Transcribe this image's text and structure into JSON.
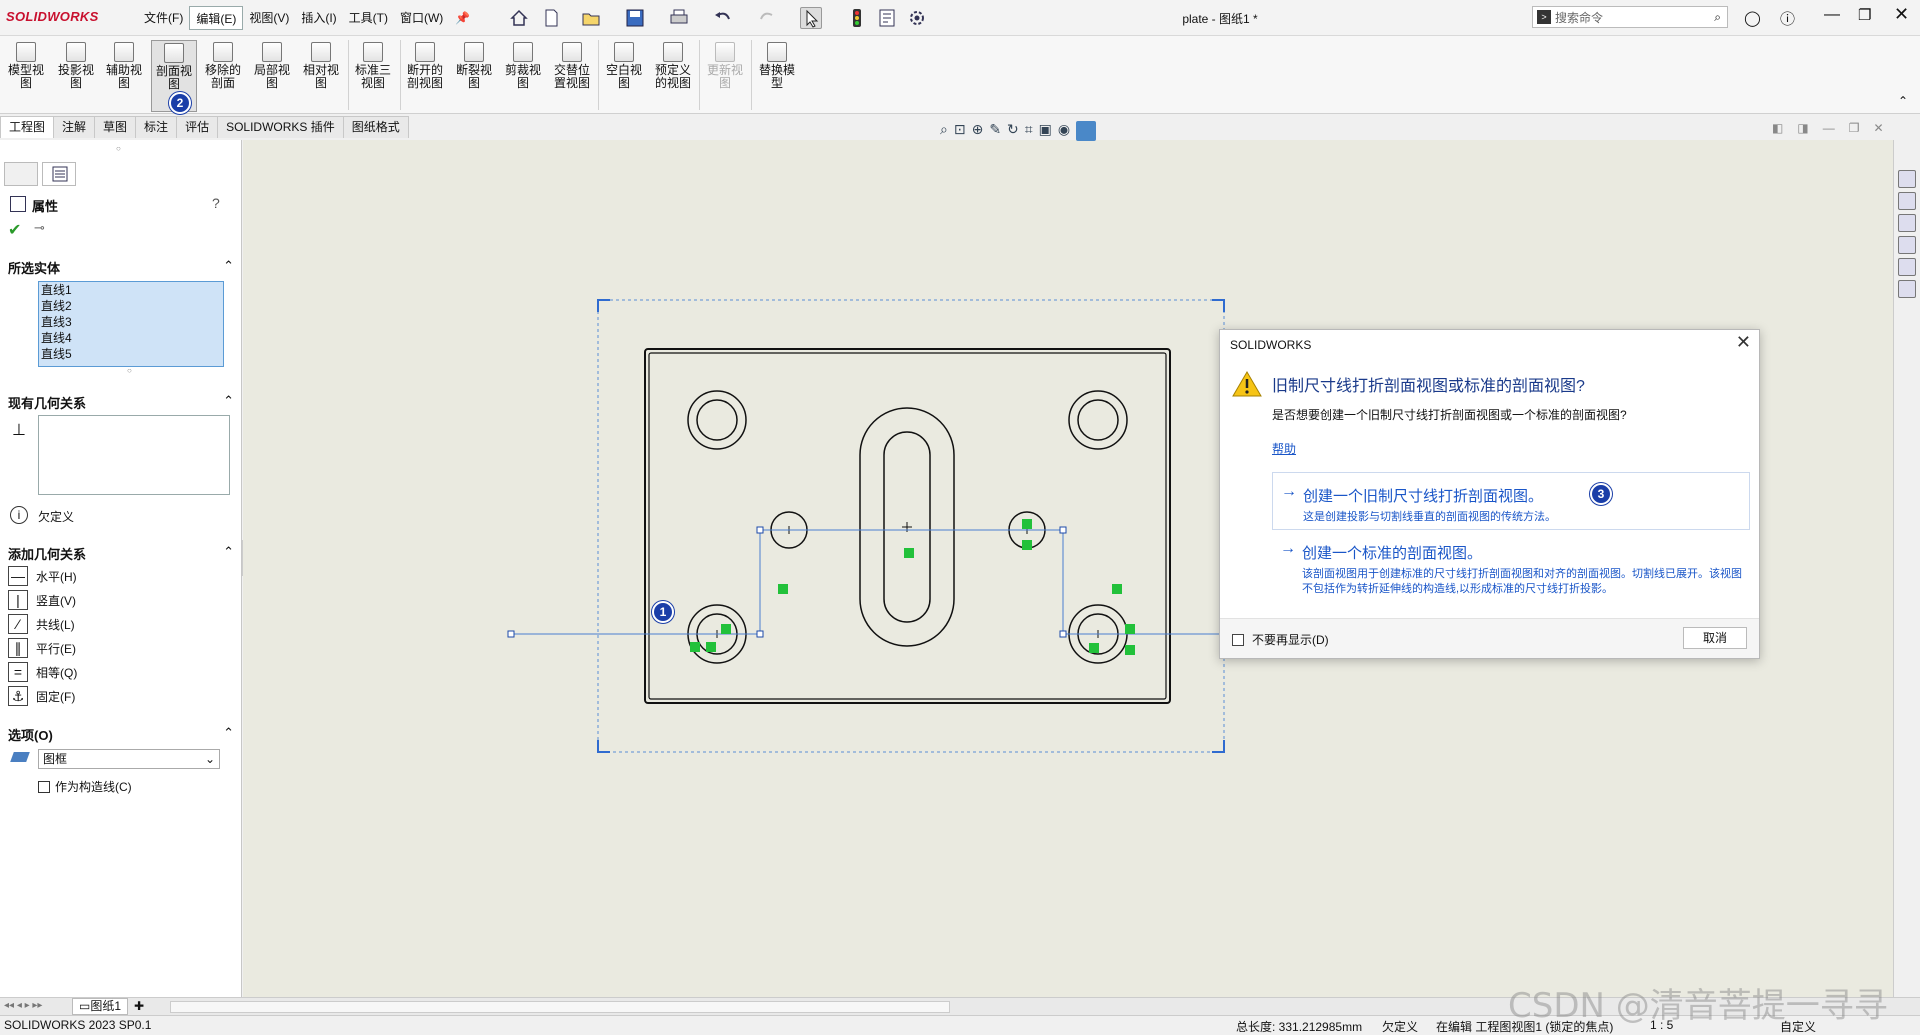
{
  "app": {
    "logo": "SOLIDWORKS",
    "doc_title": "plate - 图纸1 *"
  },
  "menu": [
    "文件(F)",
    "编辑(E)",
    "视图(V)",
    "插入(I)",
    "工具(T)",
    "窗口(W)"
  ],
  "search": {
    "placeholder": "搜索命令"
  },
  "ribbon": [
    {
      "label": "模型视图"
    },
    {
      "label": "投影视图"
    },
    {
      "label": "辅助视图"
    },
    {
      "label": "剖面视图"
    },
    {
      "label": "移除的剖面"
    },
    {
      "label": "局部视图"
    },
    {
      "label": "相对视图"
    },
    {
      "label": "标准三视图"
    },
    {
      "label": "断开的剖视图"
    },
    {
      "label": "断裂视图"
    },
    {
      "label": "剪裁视图"
    },
    {
      "label": "交替位置视图"
    },
    {
      "label": "空白视图"
    },
    {
      "label": "预定义的视图"
    },
    {
      "label": "更新视图"
    },
    {
      "label": "替换模型"
    }
  ],
  "tabs": [
    "工程图",
    "注解",
    "草图",
    "标注",
    "评估",
    "SOLIDWORKS 插件",
    "图纸格式"
  ],
  "panel": {
    "title": "属性",
    "selected_entities": {
      "header": "所选实体",
      "items": [
        "直线1",
        "直线2",
        "直线3",
        "直线4",
        "直线5"
      ]
    },
    "existing_relations": {
      "header": "现有几何关系",
      "status": "欠定义"
    },
    "add_relations": {
      "header": "添加几何关系",
      "items": [
        "水平(H)",
        "竖直(V)",
        "共线(L)",
        "平行(E)",
        "相等(Q)",
        "固定(F)"
      ]
    },
    "options": {
      "header": "选项(O)",
      "layer": "图框",
      "construction": "作为构造线(C)"
    }
  },
  "sheet_tab": "图纸1",
  "status": {
    "version": "SOLIDWORKS 2023 SP0.1",
    "length": "总长度: 331.212985mm",
    "definition": "欠定义",
    "editing": "在编辑 工程图视图1 (锁定的焦点)",
    "scale": "1 : 5",
    "custom": "自定义"
  },
  "dialog": {
    "title": "SOLIDWORKS",
    "question": "旧制尺寸线打折剖面视图或标准的剖面视图?",
    "subtitle": "是否想要创建一个旧制尺寸线打折剖面视图或一个标准的剖面视图?",
    "help": "帮助",
    "option1": {
      "title": "创建一个旧制尺寸线打折剖面视图。",
      "desc": "这是创建投影与切割线垂直的剖面视图的传统方法。"
    },
    "option2": {
      "title": "创建一个标准的剖面视图。",
      "desc": "该剖面视图用于创建标准的尺寸线打折剖面视图和对齐的剖面视图。切割线已展开。该视图不包括作为转折延伸线的构造线,以形成标准的尺寸线打折投影。"
    },
    "dont_show": "不要再显示(D)",
    "cancel": "取消"
  },
  "badges": [
    "1",
    "2",
    "3"
  ],
  "watermark": "CSDN @清音菩提一寻寻",
  "colors": {
    "accent": "#1a56c8",
    "selection": "#cfe3f7",
    "canvas": "#eaeae0",
    "relation_marker": "#22c13a"
  }
}
